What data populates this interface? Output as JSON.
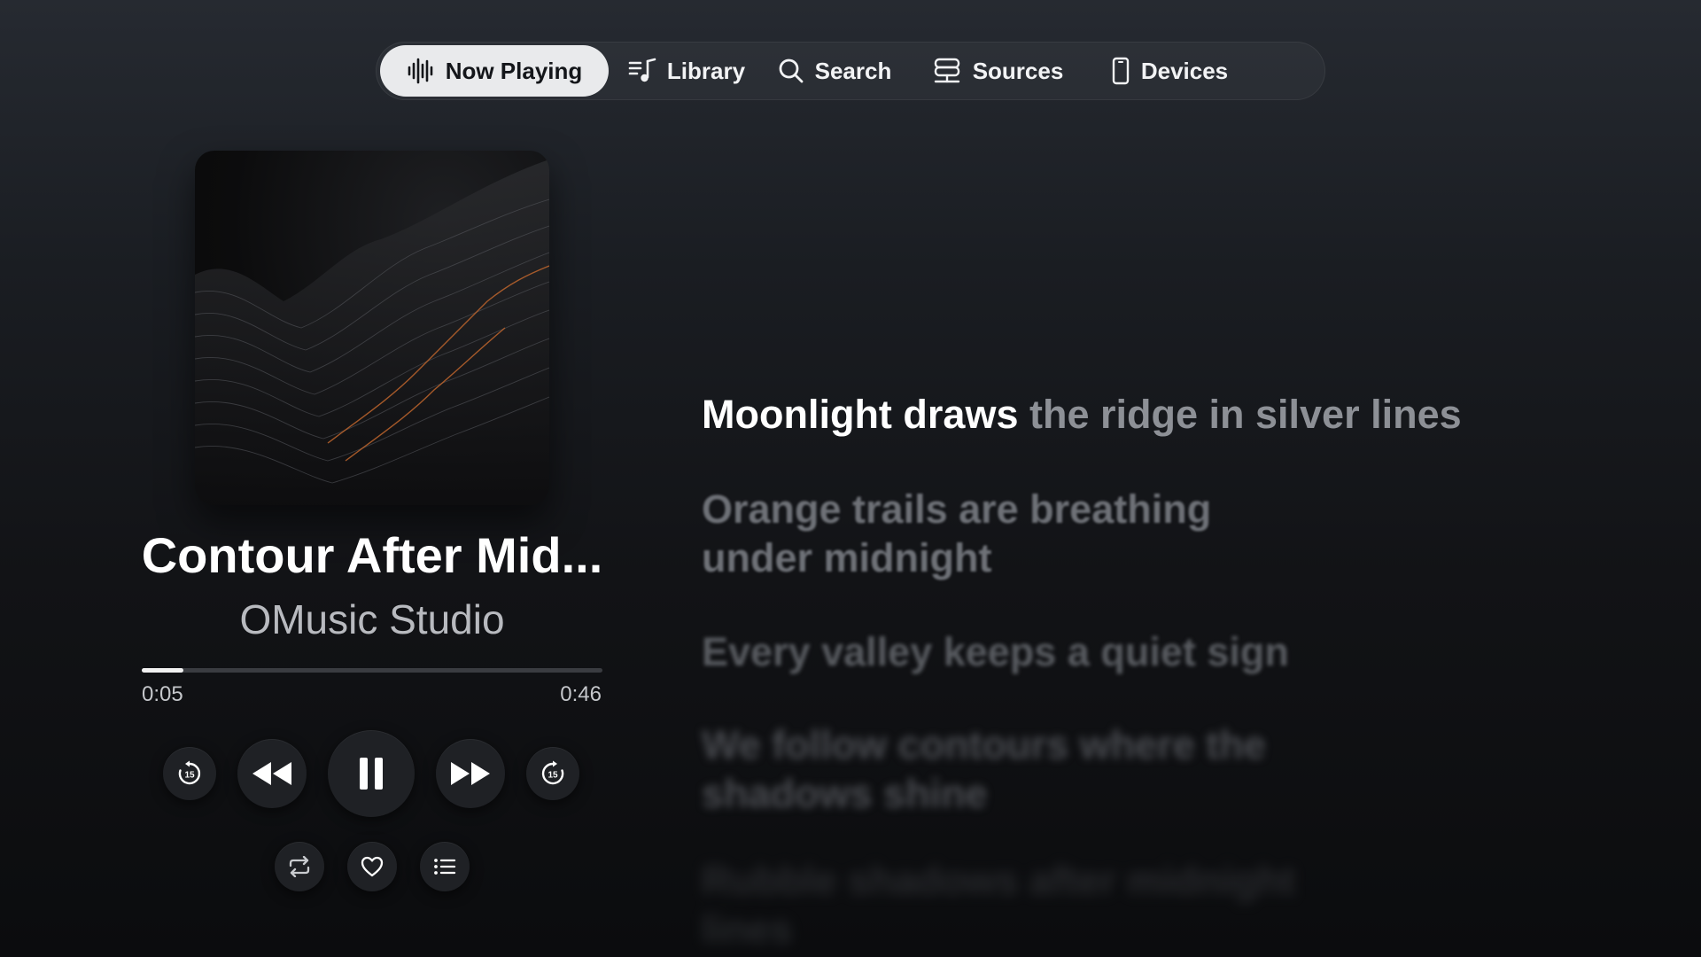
{
  "nav": {
    "items": [
      {
        "label": "Now Playing",
        "icon": "waveform-icon",
        "active": true
      },
      {
        "label": "Library",
        "icon": "music-list-icon",
        "active": false
      },
      {
        "label": "Search",
        "icon": "search-icon",
        "active": false
      },
      {
        "label": "Sources",
        "icon": "server-stack-icon",
        "active": false
      },
      {
        "label": "Devices",
        "icon": "phone-icon",
        "active": false
      }
    ]
  },
  "track": {
    "title": "Contour After Mid...",
    "artist": "OMusic Studio",
    "elapsed": "0:05",
    "duration": "0:46",
    "progress": 0.09
  },
  "controls": {
    "skip_back_seconds": "15",
    "skip_forward_seconds": "15",
    "state": "playing"
  },
  "lyrics": {
    "current_sung": "Moonlight draws",
    "current_unsung": " the ridge in silver lines",
    "lines": [
      "Orange trails are breathing under midnight",
      "Every valley keeps a quiet sign",
      "We follow contours where the shadows shine",
      "Rubble shadows after midnight lines"
    ]
  },
  "colors": {
    "accent_active_tab": "#e9eaec",
    "text_primary": "#ffffff",
    "text_secondary": "#b8babf",
    "art_highlight": "#c96a2e"
  }
}
